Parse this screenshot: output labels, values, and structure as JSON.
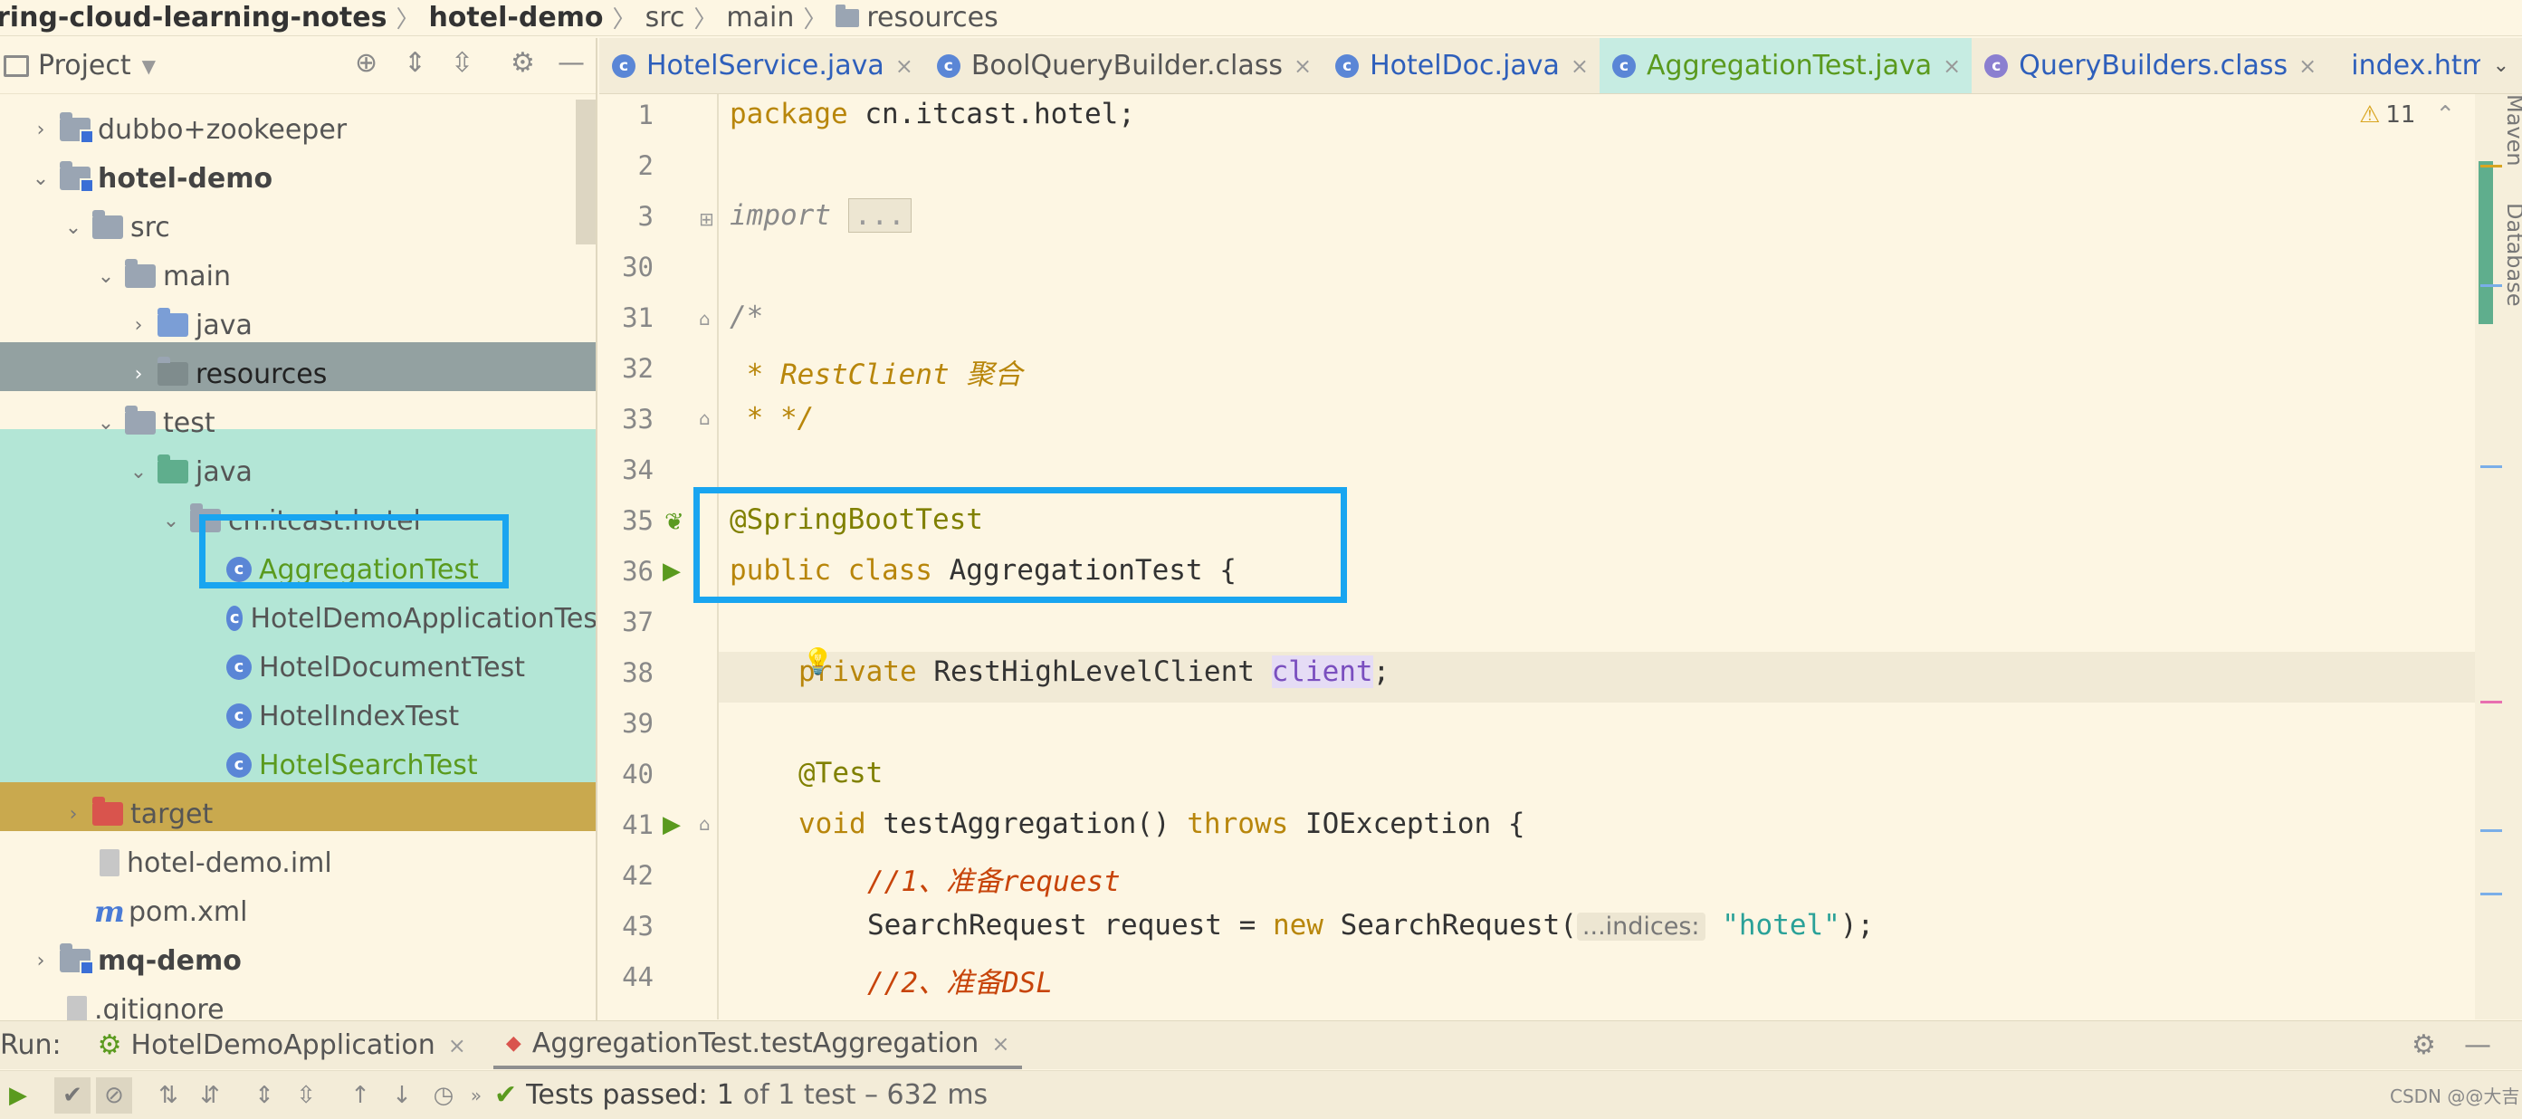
{
  "breadcrumb": [
    "ring-cloud-learning-notes",
    "hotel-demo",
    "src",
    "main",
    "resources"
  ],
  "project": {
    "title": "Project",
    "tree": [
      {
        "label": "dubbo+zookeeper"
      },
      {
        "label": "hotel-demo"
      },
      {
        "label": "src"
      },
      {
        "label": "main"
      },
      {
        "label": "java"
      },
      {
        "label": "resources"
      },
      {
        "label": "test"
      },
      {
        "label": "java"
      },
      {
        "label": "cn.itcast.hotel"
      },
      {
        "label": "AggregationTest"
      },
      {
        "label": "HotelDemoApplicationTes"
      },
      {
        "label": "HotelDocumentTest"
      },
      {
        "label": "HotelIndexTest"
      },
      {
        "label": "HotelSearchTest"
      },
      {
        "label": "target"
      },
      {
        "label": "hotel-demo.iml"
      },
      {
        "label": "pom.xml"
      },
      {
        "label": "mq-demo"
      },
      {
        "label": ".gitignore"
      }
    ]
  },
  "tabs": [
    {
      "label": "HotelService.java"
    },
    {
      "label": "BoolQueryBuilder.class"
    },
    {
      "label": "HotelDoc.java"
    },
    {
      "label": "AggregationTest.java"
    },
    {
      "label": "QueryBuilders.class"
    },
    {
      "label": "index.htm"
    }
  ],
  "editor": {
    "warnings": "11",
    "line_numbers": [
      "1",
      "2",
      "3",
      "30",
      "31",
      "32",
      "33",
      "34",
      "35",
      "36",
      "37",
      "38",
      "39",
      "40",
      "41",
      "42",
      "43",
      "44"
    ],
    "code": {
      "l1_kw": "package",
      "l1_rest": " cn.itcast.hotel;",
      "l3_import": "import",
      "l3_fold": "...",
      "l31": "/*",
      "l32": " * RestClient 聚合",
      "l33": " * */",
      "l35": "@SpringBootTest",
      "l36_kw": "public class",
      "l36_rest": " AggregationTest {",
      "l38_kw": "private",
      "l38_type": " RestHighLevelClient ",
      "l38_field": "client",
      "l38_end": ";",
      "l40": "@Test",
      "l41_kw": "void",
      "l41_mid": " testAggregation() ",
      "l41_kw2": "throws",
      "l41_end": " IOException {",
      "l42": "//1、准备request",
      "l43_a": "SearchRequest request = ",
      "l43_new": "new",
      "l43_b": " SearchRequest(",
      "l43_hint": "...indices:",
      "l43_str": "\"hotel\"",
      "l43_end": ");",
      "l44": "//2、准备DSL"
    }
  },
  "side_tools": {
    "maven": "Maven",
    "database": "Database"
  },
  "run": {
    "label": "Run:",
    "tabs": [
      "HotelDemoApplication",
      "AggregationTest.testAggregation"
    ]
  },
  "status": {
    "passed_prefix": "Tests passed:",
    "passed_count": "1",
    "passed_suffix": "of 1 test – 632 ms",
    "watermark": "CSDN @@大吉"
  },
  "colors": {
    "accent": "#19a5f0",
    "test_bg": "#b3e6d6",
    "selected_bg": "#93a1a1",
    "target_bg": "#c9a94e"
  }
}
